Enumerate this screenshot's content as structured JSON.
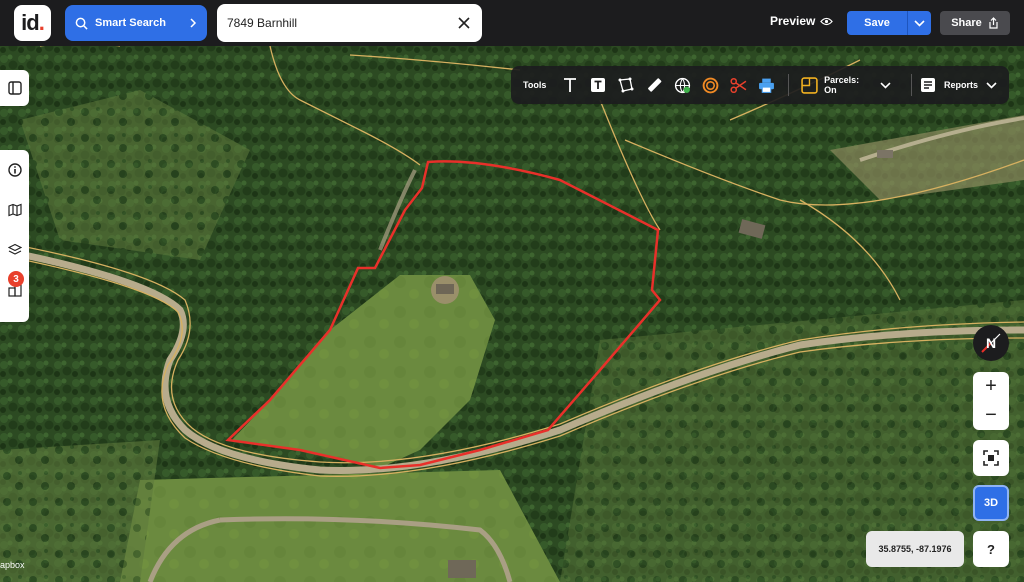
{
  "header": {
    "logo_text": "id",
    "logo_dot": ".",
    "smart_search_label": "Smart Search",
    "search_value": "7849 Barnhill",
    "preview_label": "Preview",
    "save_label": "Save",
    "share_label": "Share"
  },
  "toolbar": {
    "tools_label": "Tools",
    "icons": [
      "text-icon",
      "text-box-icon",
      "polygon-icon",
      "ruler-icon",
      "globe-icon",
      "radius-icon",
      "scissors-icon",
      "print-icon"
    ],
    "parcels_label": "Parcels: On",
    "reports_label": "Reports"
  },
  "sidebar": {
    "items": [
      "info-icon",
      "map-icon",
      "layers-icon",
      "buildings-icon"
    ],
    "badge_count": "3"
  },
  "controls": {
    "compass_label": "N",
    "zoom_in": "+",
    "zoom_out": "−",
    "btn_3d": "3D",
    "coordinates": "35.8755, -87.1976",
    "help": "?"
  },
  "attribution": "apbox",
  "colors": {
    "brand_blue": "#2f6fe6",
    "parcel_outline": "#e8302a",
    "parcel_lines": "#d6b060",
    "badge_red": "#e8402c"
  }
}
